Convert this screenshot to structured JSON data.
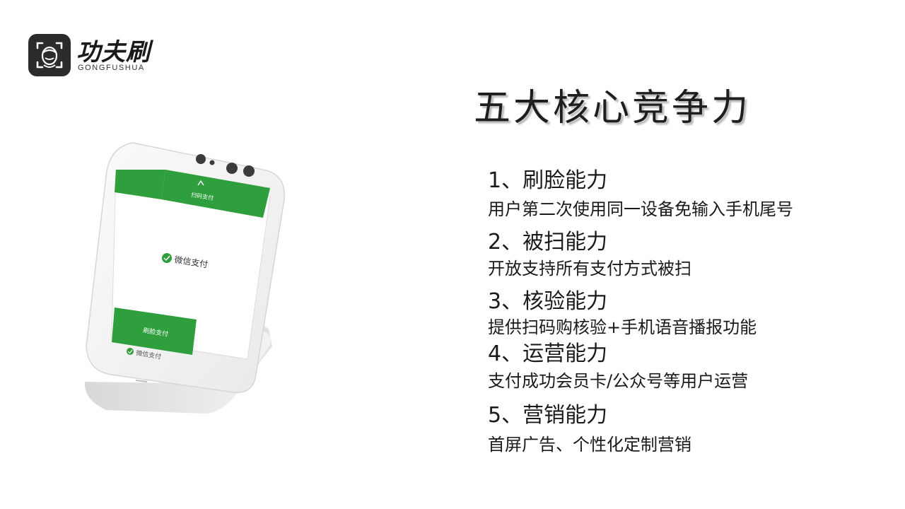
{
  "logo": {
    "name": "功夫刷",
    "subtitle": "GONGFUSHUA"
  },
  "device": {
    "screen_top_label": "扫码支付",
    "wechat_pay_label": "微信支付",
    "face_pay_button": "刷脸支付",
    "base_label": "微信支付",
    "brand_green": "#2f9e3d"
  },
  "heading": "五大核心竞争力",
  "features": [
    {
      "title": "1、刷脸能力",
      "desc": "用户第二次使用同一设备免输入手机尾号"
    },
    {
      "title": "2、被扫能力",
      "desc": "开放支持所有支付方式被扫"
    },
    {
      "title": "3、核验能力",
      "desc": "提供扫码购核验+手机语音播报功能"
    },
    {
      "title": "4、运营能力",
      "desc": "支付成功会员卡/公众号等用户运营"
    },
    {
      "title": "5、营销能力",
      "desc": "首屏广告、个性化定制营销"
    }
  ]
}
